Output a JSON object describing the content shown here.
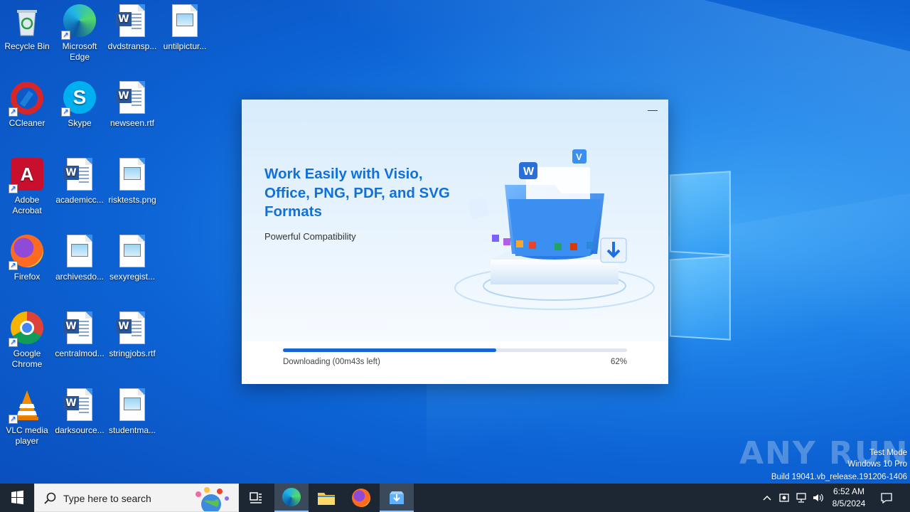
{
  "desktop": {
    "icons": [
      {
        "label": "Recycle Bin",
        "icon": "recycle-bin-icon"
      },
      {
        "label": "Microsoft Edge",
        "icon": "edge-icon"
      },
      {
        "label": "dvdstransp...",
        "icon": "word-doc-icon"
      },
      {
        "label": "untilpictur...",
        "icon": "image-file-icon"
      },
      {
        "label": "CCleaner",
        "icon": "ccleaner-icon"
      },
      {
        "label": "Skype",
        "icon": "skype-icon"
      },
      {
        "label": "newseen.rtf",
        "icon": "word-doc-icon"
      },
      {
        "label": "Adobe Acrobat",
        "icon": "acrobat-icon"
      },
      {
        "label": "academicc...",
        "icon": "word-doc-icon"
      },
      {
        "label": "risktests.png",
        "icon": "image-file-icon"
      },
      {
        "label": "Firefox",
        "icon": "firefox-icon"
      },
      {
        "label": "archivesdo...",
        "icon": "image-file-icon"
      },
      {
        "label": "sexyregist...",
        "icon": "image-file-icon"
      },
      {
        "label": "Google Chrome",
        "icon": "chrome-icon"
      },
      {
        "label": "centralmod...",
        "icon": "word-doc-icon"
      },
      {
        "label": "stringjobs.rtf",
        "icon": "word-doc-icon"
      },
      {
        "label": "VLC media player",
        "icon": "vlc-icon"
      },
      {
        "label": "darksource...",
        "icon": "word-doc-icon"
      },
      {
        "label": "studentma...",
        "icon": "image-file-icon"
      }
    ]
  },
  "installer": {
    "headline": "Work Easily with Visio, Office, PNG, PDF, and SVG Formats",
    "subtitle": "Powerful Compatibility",
    "minimize_symbol": "—",
    "status": "Downloading (00m43s left)",
    "percent_label": "62%",
    "progress": 0.62,
    "accent": "#1565d8"
  },
  "watermark": {
    "brand": "ANY RUN",
    "mode": "Test Mode",
    "edition": "Windows 10 Pro",
    "build": "Build 19041.vb_release.191206-1406"
  },
  "taskbar": {
    "search_placeholder": "Type here to search",
    "apps": [
      "task-view-icon",
      "edge-icon",
      "file-explorer-icon",
      "firefox-icon",
      "installer-icon"
    ],
    "clock_time": "6:52 AM",
    "clock_date": "8/5/2024"
  }
}
